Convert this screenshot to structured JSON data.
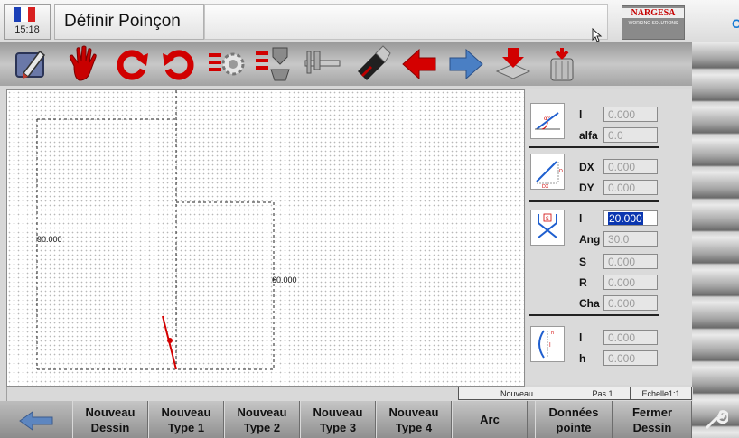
{
  "header": {
    "clock": "15:18",
    "title": "Définir Poinçon",
    "logo_name": "NARGESA",
    "logo_tagline": "WORKING SOLUTIONS"
  },
  "toolbar": {
    "icons": [
      "edit-icon",
      "hand-icon",
      "rotate-icon",
      "rotate-reverse-icon",
      "settings-icon",
      "tooling-icon",
      "caliper-icon",
      "usb-icon",
      "arrow-left-icon",
      "arrow-right-icon",
      "import-icon",
      "delete-icon"
    ]
  },
  "drawing": {
    "dim_left": "90.000",
    "dim_right": "60.000"
  },
  "panel": {
    "g1": {
      "l_label": "l",
      "l_value": "0.000",
      "alfa_label": "alfa",
      "alfa_value": "0.0"
    },
    "g2": {
      "dx_label": "DX",
      "dx_value": "0.000",
      "dy_label": "DY",
      "dy_value": "0.000"
    },
    "g3": {
      "l_label": "l",
      "l_value": "20.000",
      "ang_label": "Ang",
      "ang_value": "30.0",
      "s_label": "S",
      "s_value": "0.000",
      "r_label": "R",
      "r_value": "0.000",
      "cha_label": "Cha",
      "cha_value": "0.000"
    },
    "g4": {
      "l_label": "l",
      "l_value": "0.000",
      "h_label": "h",
      "h_value": "0.000"
    }
  },
  "status": {
    "mode": "Nouveau",
    "step": "Pas 1",
    "scale": "Echelle1:1"
  },
  "bottom": {
    "b1": [
      "Nouveau",
      "Dessin"
    ],
    "b2": [
      "Nouveau",
      "Type 1"
    ],
    "b3": [
      "Nouveau",
      "Type 2"
    ],
    "b4": [
      "Nouveau",
      "Type 3"
    ],
    "b5": [
      "Nouveau",
      "Type 4"
    ],
    "b6": "Arc",
    "b7": [
      "Données",
      "pointe"
    ],
    "b8": [
      "Fermer",
      "Dessin"
    ]
  },
  "colors": {
    "accent_red": "#d40000",
    "selection_blue": "#0a36b0",
    "arrow_blue": "#4a7fc4"
  }
}
